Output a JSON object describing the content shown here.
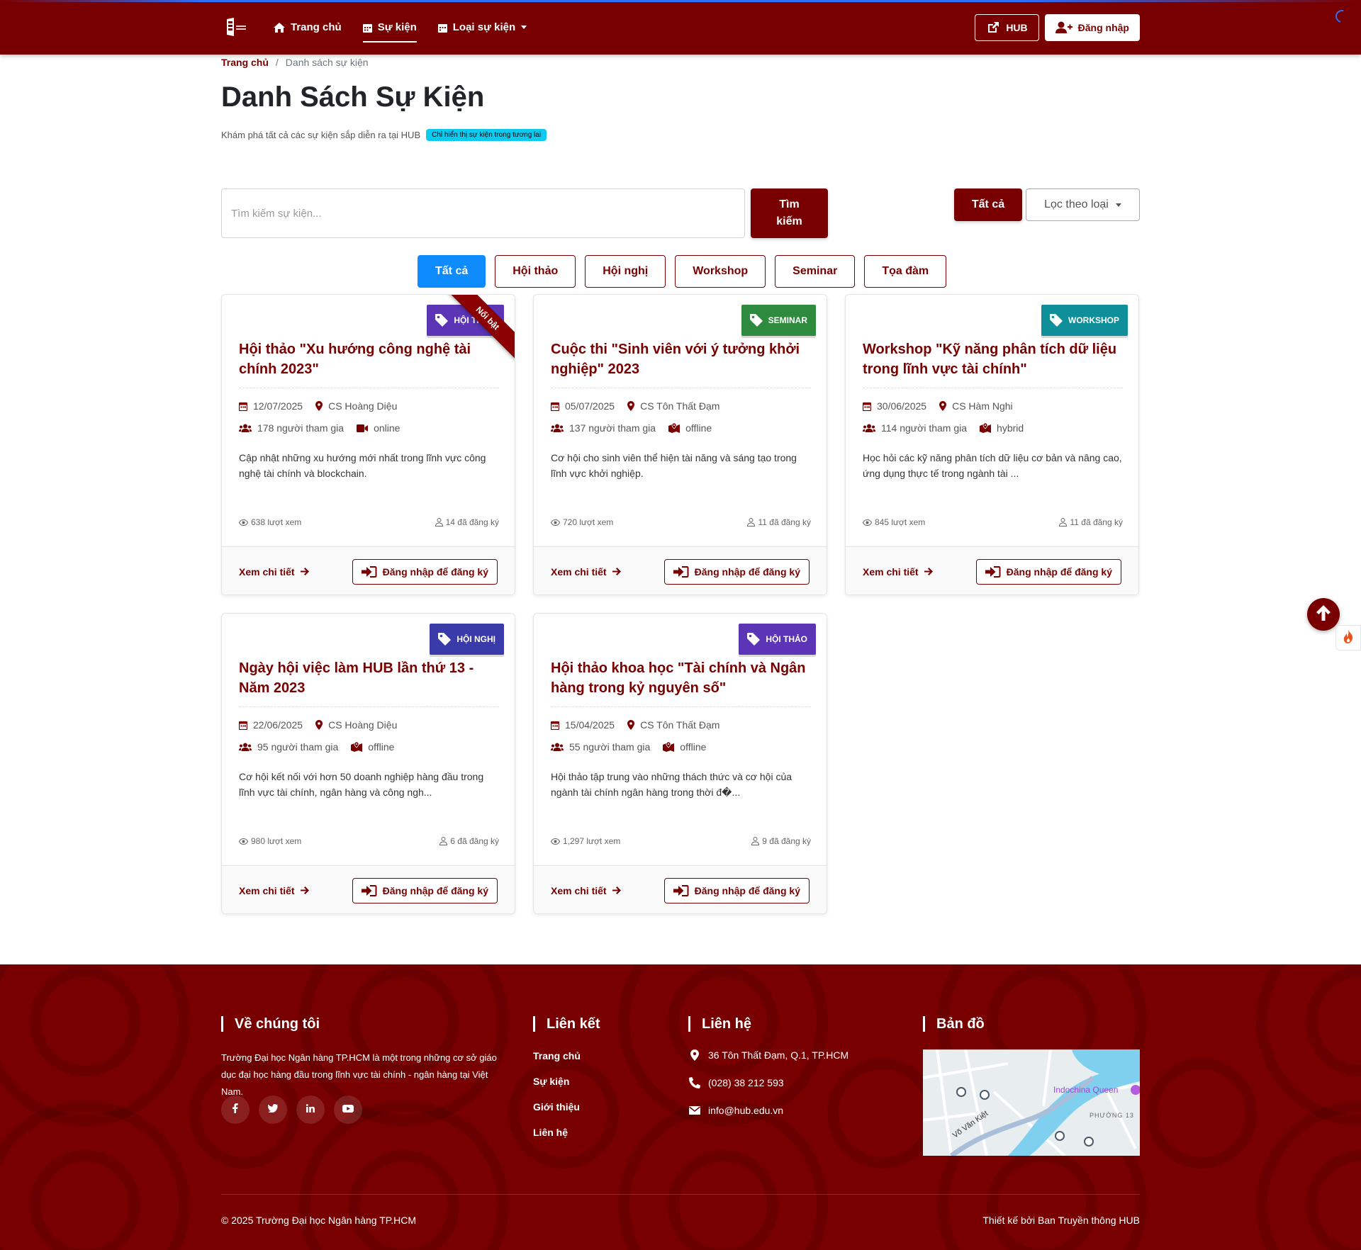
{
  "nav": {
    "home": "Trang chủ",
    "events": "Sự kiện",
    "event_types": "Loại sự kiện",
    "hub_button": "HUB",
    "login_button": "Đăng nhập"
  },
  "breadcrumb": {
    "home": "Trang chủ",
    "current": "Danh sách sự kiện"
  },
  "page": {
    "title": "Danh Sách Sự Kiện",
    "subtitle": "Khám phá tất cả các sự kiện sắp diễn ra tại HUB",
    "future_badge": "Chỉ hiển thị sự kiện trong tương lai"
  },
  "search": {
    "placeholder": "Tìm kiếm sự kiện...",
    "button": "Tìm kiếm",
    "all_button": "Tất cả",
    "filter_button": "Lọc theo loại"
  },
  "categories": [
    "Tất cả",
    "Hội thảo",
    "Hội nghị",
    "Workshop",
    "Seminar",
    "Tọa đàm"
  ],
  "events": [
    {
      "type": "HỘI THẢO",
      "type_color": "#5b35b5",
      "featured": "Nổi bật",
      "title": "Hội thảo \"Xu hướng công nghệ tài chính 2023\"",
      "date": "12/07/2025",
      "location": "CS Hoàng Diệu",
      "participants": "178 người tham gia",
      "mode": "online",
      "description": "Cập nhật những xu hướng mới nhất trong lĩnh vực công nghệ tài chính và blockchain.",
      "views": "638 lượt xem",
      "registered": "14 đã đăng ký",
      "detail": "Xem chi tiết",
      "register": "Đăng nhập để đăng ký"
    },
    {
      "type": "SEMINAR",
      "type_color": "#2e8b3d",
      "featured": "",
      "title": "Cuộc thi \"Sinh viên với ý tưởng khởi nghiệp\" 2023",
      "date": "05/07/2025",
      "location": "CS Tôn Thất Đạm",
      "participants": "137 người tham gia",
      "mode": "offline",
      "description": "Cơ hội cho sinh viên thể hiện tài năng và sáng tạo trong lĩnh vực khởi nghiệp.",
      "views": "720 lượt xem",
      "registered": "11 đã đăng ký",
      "detail": "Xem chi tiết",
      "register": "Đăng nhập để đăng ký"
    },
    {
      "type": "WORKSHOP",
      "type_color": "#0e8f9a",
      "featured": "",
      "title": "Workshop \"Kỹ năng phân tích dữ liệu trong lĩnh vực tài chính\"",
      "date": "30/06/2025",
      "location": "CS Hàm Nghi",
      "participants": "114 người tham gia",
      "mode": "hybrid",
      "description": "Học hỏi các kỹ năng phân tích dữ liệu cơ bản và nâng cao, ứng dụng thực tế trong ngành tài ...",
      "views": "845 lượt xem",
      "registered": "11 đã đăng ký",
      "detail": "Xem chi tiết",
      "register": "Đăng nhập để đăng ký"
    },
    {
      "type": "HỘI NGHỊ",
      "type_color": "#3a3aa8",
      "featured": "",
      "title": "Ngày hội việc làm HUB lần thứ 13 - Năm 2023",
      "date": "22/06/2025",
      "location": "CS Hoàng Diệu",
      "participants": "95 người tham gia",
      "mode": "offline",
      "description": "Cơ hội kết nối với hơn 50 doanh nghiệp hàng đầu trong lĩnh vực tài chính, ngân hàng và công ngh...",
      "views": "980 lượt xem",
      "registered": "6 đã đăng ký",
      "detail": "Xem chi tiết",
      "register": "Đăng nhập để đăng ký"
    },
    {
      "type": "HỘI THẢO",
      "type_color": "#5b35b5",
      "featured": "",
      "title": "Hội thảo khoa học \"Tài chính và Ngân hàng trong kỷ nguyên số\"",
      "date": "15/04/2025",
      "location": "CS Tôn Thất Đạm",
      "participants": "55 người tham gia",
      "mode": "offline",
      "description": "Hội thảo tập trung vào những thách thức và cơ hội của ngành tài chính ngân hàng trong thời đ�...",
      "views": "1,297 lượt xem",
      "registered": "9 đã đăng ký",
      "detail": "Xem chi tiết",
      "register": "Đăng nhập để đăng ký"
    }
  ],
  "footer": {
    "about_title": "Về chúng tôi",
    "about_text": "Trường Đại học Ngân hàng TP.HCM là một trong những cơ sở giáo dục đại học hàng đầu trong lĩnh vực tài chính - ngân hàng tại Việt Nam.",
    "links_title": "Liên kết",
    "links": [
      "Trang chủ",
      "Sự kiện",
      "Giới thiệu",
      "Liên hệ"
    ],
    "contact_title": "Liên hệ",
    "address": "36 Tôn Thất Đạm, Q.1, TP.HCM",
    "phone": "(028) 38 212 593",
    "email": "info@hub.edu.vn",
    "map_title": "Bản đồ",
    "map_labels": {
      "place": "Indochina Queen",
      "ward": "PHƯỜNG 13",
      "street": "Võ Văn Kiệt"
    },
    "copyright": "© 2025 Trường Đại học Ngân hàng TP.HCM",
    "designer": "Thiết kế bởi Ban Truyền thông HUB"
  },
  "colors": {
    "brand": "#790000",
    "active_pill": "#0d8bff",
    "future_badge": "#0dcaf0"
  }
}
